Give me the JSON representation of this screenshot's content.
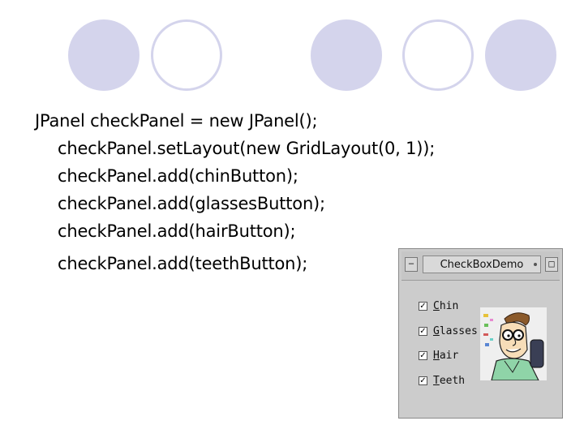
{
  "slide": {
    "code_lines": [
      "JPanel checkPanel = new JPanel();",
      "checkPanel.setLayout(new GridLayout(0, 1));",
      "checkPanel.add(chinButton);",
      "checkPanel.add(glassesButton);",
      "checkPanel.add(hairButton);",
      "checkPanel.add(teethButton);"
    ]
  },
  "window": {
    "title": "CheckBoxDemo",
    "minimize_glyph": "−",
    "maximize_glyph": "□",
    "checkboxes": [
      {
        "mnemonic": "C",
        "rest": "hin",
        "checked": true
      },
      {
        "mnemonic": "G",
        "rest": "lasses",
        "checked": true
      },
      {
        "mnemonic": "H",
        "rest": "air",
        "checked": true
      },
      {
        "mnemonic": "T",
        "rest": "eeth",
        "checked": true
      }
    ],
    "check_glyph": "✓"
  },
  "colors": {
    "circle_fill": "#d4d4ec",
    "window_bg": "#cccccc"
  },
  "icons": {
    "window_menu": "window-menu-icon",
    "minimize": "minimize-icon",
    "maximize": "maximize-icon",
    "picture": "cartoon-face-icon"
  }
}
